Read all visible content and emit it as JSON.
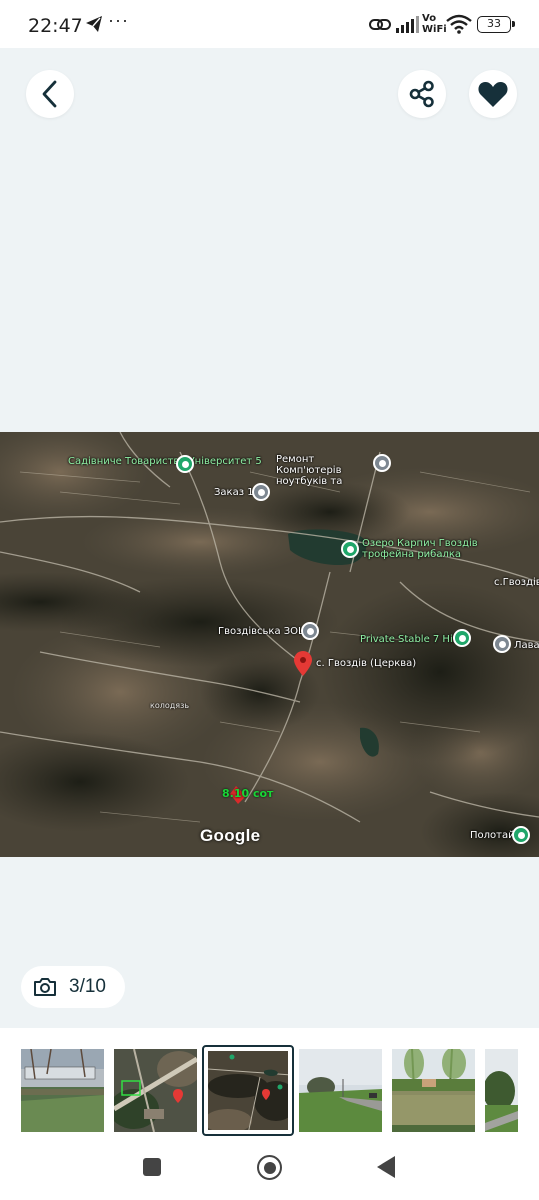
{
  "status_bar": {
    "time": "22:47",
    "dots": "···",
    "network": "Vo WiFi",
    "battery": "33"
  },
  "toolbar": {
    "back_icon": "chevron-left-icon",
    "share_icon": "share-icon",
    "favorite_icon": "heart-icon"
  },
  "photo": {
    "map_labels": {
      "garden_society": "Садівниче Товариство Університет 5",
      "computer_repair": "Ремонт Комп'ютерів ноутбуків та",
      "order": "Заказ 1",
      "lake": "Озеро Карпич Гвоздів трофейна рибалка",
      "village_gvozdiv": "с.Гвоздів",
      "school": "Гвоздівська ЗОШ",
      "stable": "Private Stable 7 Hills",
      "lava": "Лава",
      "church": "с. Гвоздів (Церква)",
      "well": "колодязь",
      "plot": "8.10 сот",
      "polotai": "Полотай",
      "google": "Google"
    }
  },
  "counter": {
    "icon": "camera-icon",
    "text": "3/10"
  },
  "thumbnails": [
    {
      "name": "thumb-1",
      "scene": "yard"
    },
    {
      "name": "thumb-2",
      "scene": "map-plot"
    },
    {
      "name": "thumb-3",
      "scene": "satellite",
      "active": true
    },
    {
      "name": "thumb-4",
      "scene": "road"
    },
    {
      "name": "thumb-5",
      "scene": "lake"
    },
    {
      "name": "thumb-6",
      "scene": "path"
    }
  ],
  "colors": {
    "background": "#eef3f5",
    "accent": "#16303a",
    "pin_green": "#20a66a",
    "pin_red": "#e53935",
    "plot_label": "#18d636"
  }
}
